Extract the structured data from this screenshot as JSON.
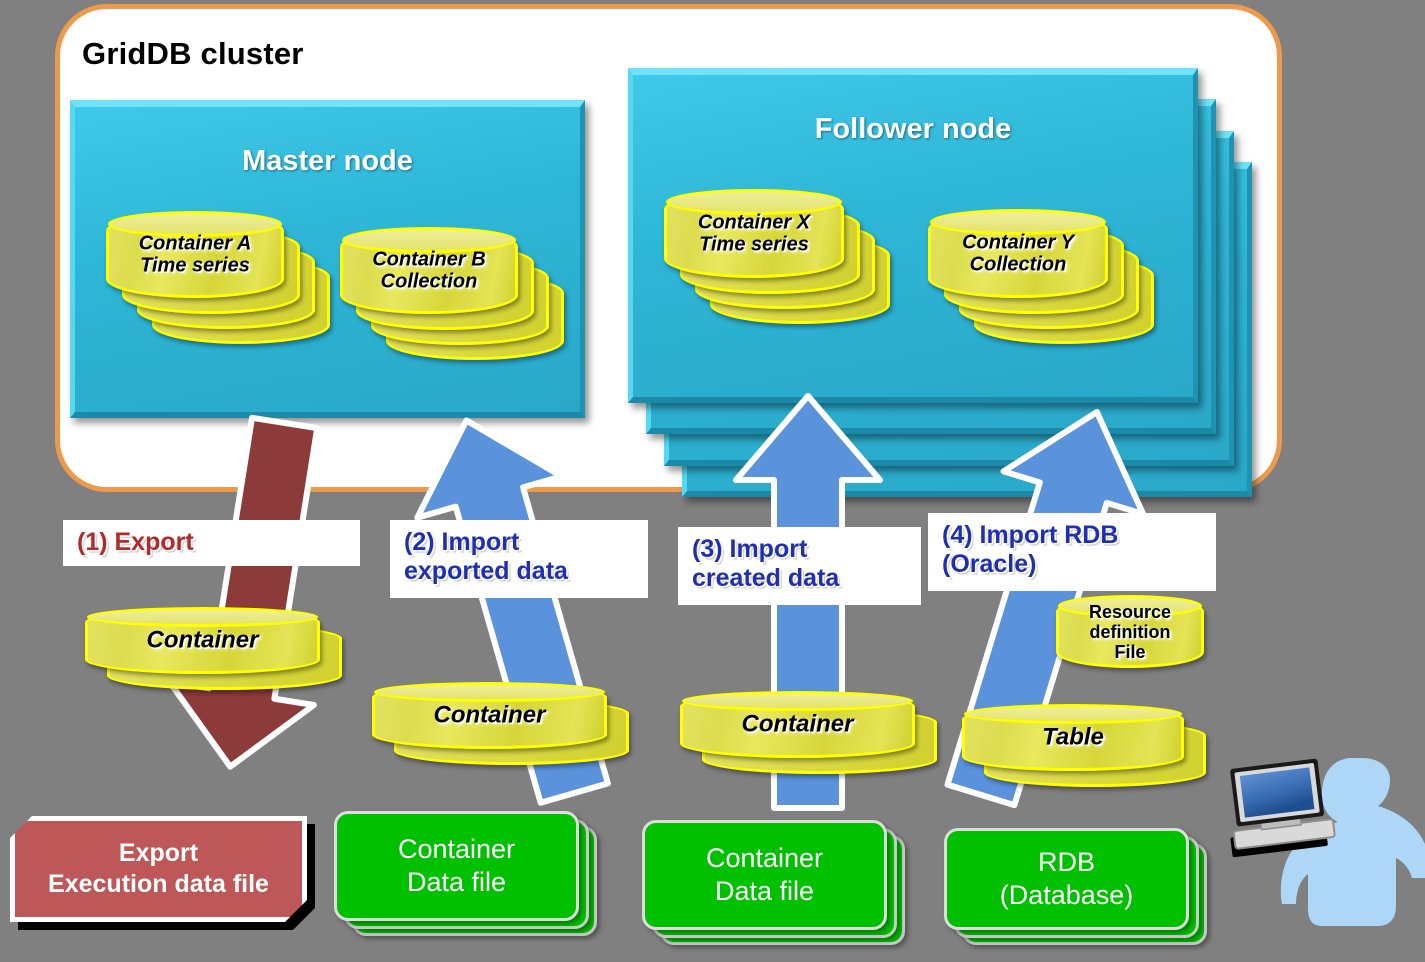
{
  "diagram": {
    "title": "GridDB cluster",
    "background_color": "#808080",
    "cluster_border_color": "#ED9A4A",
    "node_color": "#2EB6D6",
    "container_color": "#DCDC4E",
    "export_color": "#B02B2B",
    "import_color": "#1F2FAF",
    "file_box_color": "#00C000"
  },
  "cluster": {
    "title": "GridDB cluster",
    "master_node": {
      "label": "Master node",
      "containers": [
        {
          "line1": "Container A",
          "line2": "Time series"
        },
        {
          "line1": "Container B",
          "line2": "Collection"
        }
      ]
    },
    "follower_node": {
      "label": "Follower node",
      "stack_count": 4,
      "containers": [
        {
          "line1": "Container X",
          "line2": "Time series"
        },
        {
          "line1": "Container Y",
          "line2": "Collection"
        }
      ]
    }
  },
  "flows": [
    {
      "id": "export",
      "label_lines": [
        "(1) Export"
      ],
      "direction": "down",
      "arrow_color": "#8C3A3A",
      "text_color": "#B02B2B",
      "cylinder": "Container",
      "target_line1": "Export",
      "target_line2": "Execution data file"
    },
    {
      "id": "import-exported-data",
      "label_lines": [
        "(2) Import",
        "exported data"
      ],
      "direction": "up",
      "arrow_color": "#5B92DC",
      "text_color": "#1F2FAF",
      "cylinder": "Container",
      "target_line1": "Container",
      "target_line2": "Data file"
    },
    {
      "id": "import-created-data",
      "label_lines": [
        "(3) Import",
        "created data"
      ],
      "direction": "up",
      "arrow_color": "#5B92DC",
      "text_color": "#1F2FAF",
      "cylinder": "Container",
      "target_line1": "Container",
      "target_line2": "Data file"
    },
    {
      "id": "import-rdb-oracle",
      "label_lines": [
        "(4) Import RDB",
        "(Oracle)"
      ],
      "direction": "up",
      "arrow_color": "#5B92DC",
      "text_color": "#1F2FAF",
      "cylinder": "Table",
      "resource_file": [
        "Resource",
        "definition",
        "File"
      ],
      "target_line1": "RDB",
      "target_line2": "(Database)"
    }
  ],
  "actor": {
    "name": "user-with-computer",
    "person_color": "#AED6F7",
    "screen_color": "#3B6FB5"
  }
}
